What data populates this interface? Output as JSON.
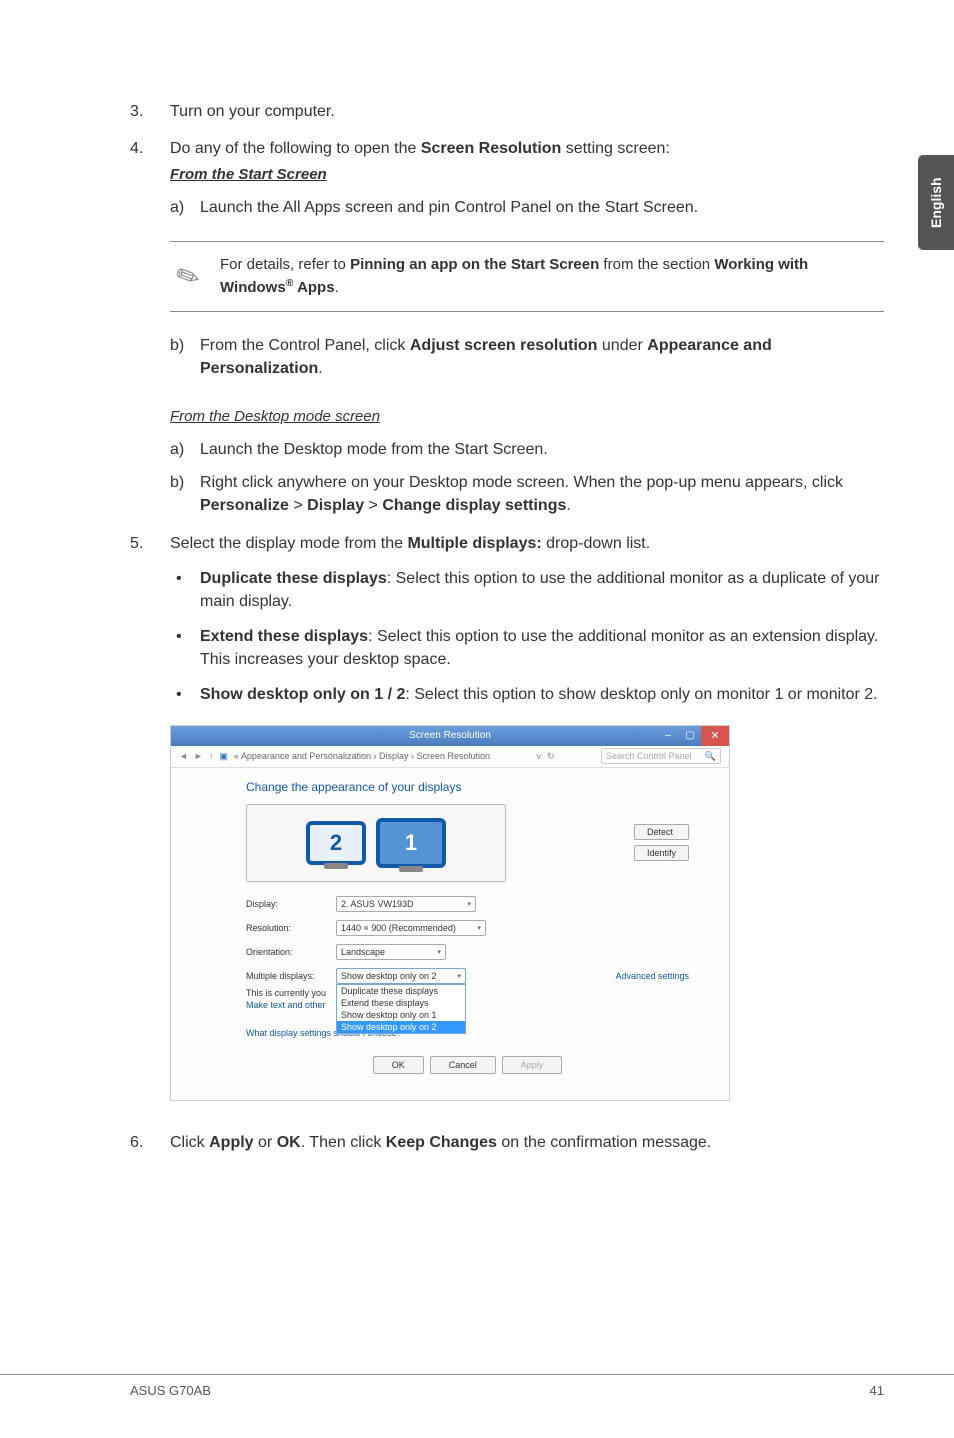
{
  "sideTab": "English",
  "items": {
    "step3": {
      "num": "3.",
      "text": "Turn on your computer."
    },
    "step4": {
      "num": "4.",
      "intro_a": "Do any of the following to open the ",
      "intro_b": "Screen Resolution",
      "intro_c": " setting screen:",
      "from_start": "From the Start Screen",
      "a_letter": "a)",
      "a_text": "Launch the All Apps screen and pin Control Panel on the Start Screen."
    },
    "note": {
      "a": "For details, refer to ",
      "b": "Pinning an app on the Start Screen",
      "c": " from the section ",
      "d": "Working with Windows",
      "e": " Apps",
      "f": "."
    },
    "step4b": {
      "letter": "b)",
      "a": "From the Control Panel, click ",
      "b": "Adjust screen resolution",
      "c": " under ",
      "d": "Appearance and Personalization",
      "e": "."
    },
    "from_desktop": "From the Desktop mode screen",
    "da": {
      "letter": "a)",
      "text": "Launch the Desktop mode from the Start Screen."
    },
    "db": {
      "letter": "b)",
      "a": "Right click anywhere on your Desktop mode screen. When the pop-up menu appears, click ",
      "b": "Personalize",
      "c": " > ",
      "d": "Display",
      "e": " > ",
      "f": "Change display settings",
      "g": "."
    },
    "step5": {
      "num": "5.",
      "a": "Select the display mode from the ",
      "b": "Multiple displays:",
      "c": " drop-down list."
    },
    "bul1": {
      "b": "Duplicate these displays",
      "t": ": Select this option to use the additional monitor as a duplicate of your main display."
    },
    "bul2": {
      "b": "Extend these displays",
      "t": ": Select this option to use the additional monitor as an extension display. This increases your desktop space."
    },
    "bul3": {
      "b": "Show desktop only on 1 / 2",
      "t": ": Select this option to show desktop only on monitor 1 or monitor 2."
    },
    "step6": {
      "num": "6.",
      "a": "Click ",
      "b": "Apply",
      "c": " or ",
      "d": "OK",
      "e": ". Then click ",
      "f": "Keep Changes",
      "g": " on the confirmation message."
    }
  },
  "scr": {
    "title": "Screen Resolution",
    "breadcrumb": "« Appearance and Personalization › Display › Screen Resolution",
    "search": "Search Control Panel",
    "heading": "Change the appearance of your displays",
    "detect": "Detect",
    "identify": "Identify",
    "mon2": "2",
    "mon1": "1",
    "fields": {
      "display": {
        "lbl": "Display:",
        "val": "2. ASUS VW193D"
      },
      "resolution": {
        "lbl": "Resolution:",
        "val": "1440 × 900 (Recommended)"
      },
      "orientation": {
        "lbl": "Orientation:",
        "val": "Landscape"
      },
      "multiple": {
        "lbl": "Multiple displays:",
        "val": "Show desktop only on 2"
      }
    },
    "dropdown": {
      "o1": "Duplicate these displays",
      "o2": "Extend these displays",
      "o3": "Show desktop only on 1",
      "o4": "Show desktop only on 2"
    },
    "currently": "This is currently you",
    "make_text": "Make text and other",
    "advanced": "Advanced settings",
    "whatlink": "What display settings should I choose?",
    "ok": "OK",
    "cancel": "Cancel",
    "apply": "Apply"
  },
  "footer": {
    "left": "ASUS G70AB",
    "right": "41"
  }
}
